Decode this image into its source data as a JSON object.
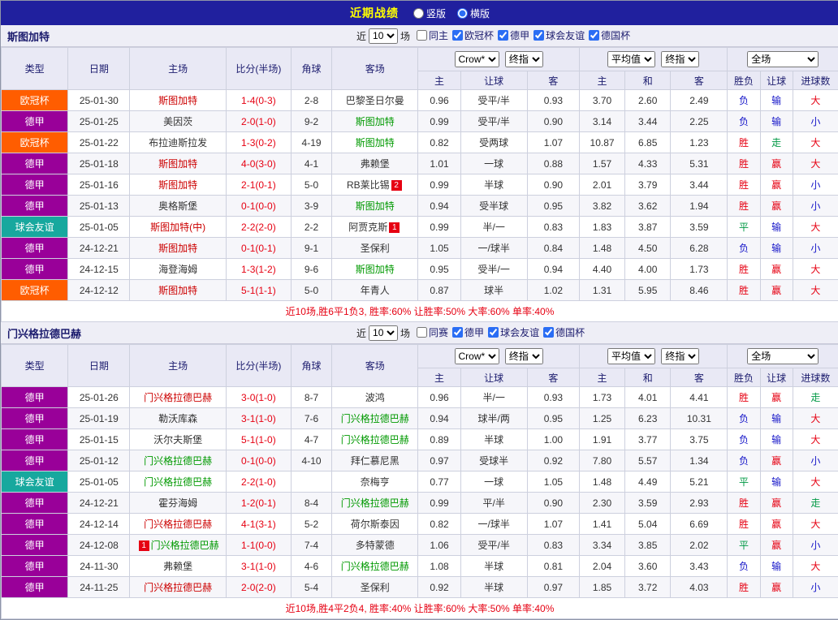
{
  "topbar": {
    "title": "近期战绩",
    "layout_options": [
      {
        "key": "vertical",
        "label": "竖版",
        "selected": false
      },
      {
        "key": "horizontal",
        "label": "横版",
        "selected": true
      }
    ]
  },
  "filter": {
    "prefix": "近",
    "count": "10",
    "suffix": "场"
  },
  "table_header": {
    "cols": [
      "类型",
      "日期",
      "主场",
      "比分(半场)",
      "角球",
      "客场"
    ],
    "odds_group": {
      "select1": "Crow*",
      "select2": "终指",
      "sub": [
        "主",
        "让球",
        "客"
      ]
    },
    "avg_group": {
      "select1": "平均值",
      "select2": "终指",
      "sub": [
        "主",
        "和",
        "客"
      ]
    },
    "result_group": {
      "select": "全场",
      "sub": [
        "胜负",
        "让球",
        "进球数"
      ]
    }
  },
  "colors": {
    "type_badges": {
      "欧冠杯": "#ff5d00",
      "德甲": "#990099",
      "球会友谊": "#17a89e"
    },
    "team": {
      "red": "#cc0000",
      "green": "#009900",
      "black": "#333333"
    },
    "results": {
      "胜": "#e60012",
      "赢": "#e60012",
      "大": "#e60012",
      "负": "#1414c8",
      "输": "#1414c8",
      "小": "#1414c8",
      "平": "#009944",
      "走": "#009944"
    },
    "score": "#e60012",
    "topbar_bg": "#20209e",
    "title_color": "#ffff00"
  },
  "sections": [
    {
      "key": "stuttgart",
      "team": "斯图加特",
      "filters": [
        {
          "key": "same-home",
          "label": "同主",
          "checked": false
        },
        {
          "key": "ucl",
          "label": "欧冠杯",
          "checked": true
        },
        {
          "key": "bundesliga",
          "label": "德甲",
          "checked": true
        },
        {
          "key": "club-friendly",
          "label": "球会友谊",
          "checked": true
        },
        {
          "key": "german-cup",
          "label": "德国杯",
          "checked": true
        }
      ],
      "rows": [
        {
          "type": "欧冠杯",
          "date": "25-01-30",
          "home": {
            "name": "斯图加特",
            "color": "red"
          },
          "score": "1-4(0-3)",
          "corner": "2-8",
          "away": {
            "name": "巴黎圣日尔曼",
            "color": "black"
          },
          "odds": [
            "0.96",
            "受平/半",
            "0.93"
          ],
          "avg": [
            "3.70",
            "2.60",
            "2.49"
          ],
          "results": [
            "负",
            "输",
            "大"
          ]
        },
        {
          "type": "德甲",
          "date": "25-01-25",
          "home": {
            "name": "美因茨",
            "color": "black"
          },
          "score": "2-0(1-0)",
          "corner": "9-2",
          "away": {
            "name": "斯图加特",
            "color": "green"
          },
          "odds": [
            "0.99",
            "受平/半",
            "0.90"
          ],
          "avg": [
            "3.14",
            "3.44",
            "2.25"
          ],
          "results": [
            "负",
            "输",
            "小"
          ]
        },
        {
          "type": "欧冠杯",
          "date": "25-01-22",
          "home": {
            "name": "布拉迪斯拉发",
            "color": "black"
          },
          "score": "1-3(0-2)",
          "corner": "4-19",
          "away": {
            "name": "斯图加特",
            "color": "green"
          },
          "odds": [
            "0.82",
            "受两球",
            "1.07"
          ],
          "avg": [
            "10.87",
            "6.85",
            "1.23"
          ],
          "results": [
            "胜",
            "走",
            "大"
          ]
        },
        {
          "type": "德甲",
          "date": "25-01-18",
          "home": {
            "name": "斯图加特",
            "color": "red"
          },
          "score": "4-0(3-0)",
          "corner": "4-1",
          "away": {
            "name": "弗赖堡",
            "color": "black"
          },
          "odds": [
            "1.01",
            "一球",
            "0.88"
          ],
          "avg": [
            "1.57",
            "4.33",
            "5.31"
          ],
          "results": [
            "胜",
            "赢",
            "大"
          ]
        },
        {
          "type": "德甲",
          "date": "25-01-16",
          "home": {
            "name": "斯图加特",
            "color": "red"
          },
          "score": "2-1(0-1)",
          "corner": "5-0",
          "away": {
            "name": "RB莱比锡",
            "color": "black",
            "badge": "2"
          },
          "odds": [
            "0.99",
            "半球",
            "0.90"
          ],
          "avg": [
            "2.01",
            "3.79",
            "3.44"
          ],
          "results": [
            "胜",
            "赢",
            "小"
          ]
        },
        {
          "type": "德甲",
          "date": "25-01-13",
          "home": {
            "name": "奥格斯堡",
            "color": "black"
          },
          "score": "0-1(0-0)",
          "corner": "3-9",
          "away": {
            "name": "斯图加特",
            "color": "green"
          },
          "odds": [
            "0.94",
            "受半球",
            "0.95"
          ],
          "avg": [
            "3.82",
            "3.62",
            "1.94"
          ],
          "results": [
            "胜",
            "赢",
            "小"
          ]
        },
        {
          "type": "球会友谊",
          "date": "25-01-05",
          "home": {
            "name": "斯图加特(中)",
            "color": "red"
          },
          "score": "2-2(2-0)",
          "corner": "2-2",
          "away": {
            "name": "阿贾克斯",
            "color": "black",
            "badge": "1"
          },
          "odds": [
            "0.99",
            "半/一",
            "0.83"
          ],
          "avg": [
            "1.83",
            "3.87",
            "3.59"
          ],
          "results": [
            "平",
            "输",
            "大"
          ]
        },
        {
          "type": "德甲",
          "date": "24-12-21",
          "home": {
            "name": "斯图加特",
            "color": "red"
          },
          "score": "0-1(0-1)",
          "corner": "9-1",
          "away": {
            "name": "圣保利",
            "color": "black"
          },
          "odds": [
            "1.05",
            "一/球半",
            "0.84"
          ],
          "avg": [
            "1.48",
            "4.50",
            "6.28"
          ],
          "results": [
            "负",
            "输",
            "小"
          ]
        },
        {
          "type": "德甲",
          "date": "24-12-15",
          "home": {
            "name": "海登海姆",
            "color": "black"
          },
          "score": "1-3(1-2)",
          "corner": "9-6",
          "away": {
            "name": "斯图加特",
            "color": "green"
          },
          "odds": [
            "0.95",
            "受半/一",
            "0.94"
          ],
          "avg": [
            "4.40",
            "4.00",
            "1.73"
          ],
          "results": [
            "胜",
            "赢",
            "大"
          ]
        },
        {
          "type": "欧冠杯",
          "date": "24-12-12",
          "home": {
            "name": "斯图加特",
            "color": "red"
          },
          "score": "5-1(1-1)",
          "corner": "5-0",
          "away": {
            "name": "年青人",
            "color": "black"
          },
          "odds": [
            "0.87",
            "球半",
            "1.02"
          ],
          "avg": [
            "1.31",
            "5.95",
            "8.46"
          ],
          "results": [
            "胜",
            "赢",
            "大"
          ]
        }
      ],
      "summary": "近10场,胜6平1负3, 胜率:60% 让胜率:50% 大率:60% 单率:40%"
    },
    {
      "key": "gladbach",
      "team": "门兴格拉德巴赫",
      "filters": [
        {
          "key": "same-competition",
          "label": "同赛",
          "checked": false
        },
        {
          "key": "bundesliga",
          "label": "德甲",
          "checked": true
        },
        {
          "key": "club-friendly",
          "label": "球会友谊",
          "checked": true
        },
        {
          "key": "german-cup",
          "label": "德国杯",
          "checked": true
        }
      ],
      "rows": [
        {
          "type": "德甲",
          "date": "25-01-26",
          "home": {
            "name": "门兴格拉德巴赫",
            "color": "red"
          },
          "score": "3-0(1-0)",
          "corner": "8-7",
          "away": {
            "name": "波鸿",
            "color": "black"
          },
          "odds": [
            "0.96",
            "半/一",
            "0.93"
          ],
          "avg": [
            "1.73",
            "4.01",
            "4.41"
          ],
          "results": [
            "胜",
            "赢",
            "走"
          ]
        },
        {
          "type": "德甲",
          "date": "25-01-19",
          "home": {
            "name": "勒沃库森",
            "color": "black"
          },
          "score": "3-1(1-0)",
          "corner": "7-6",
          "away": {
            "name": "门兴格拉德巴赫",
            "color": "green"
          },
          "odds": [
            "0.94",
            "球半/两",
            "0.95"
          ],
          "avg": [
            "1.25",
            "6.23",
            "10.31"
          ],
          "results": [
            "负",
            "输",
            "大"
          ]
        },
        {
          "type": "德甲",
          "date": "25-01-15",
          "home": {
            "name": "沃尔夫斯堡",
            "color": "black"
          },
          "score": "5-1(1-0)",
          "corner": "4-7",
          "away": {
            "name": "门兴格拉德巴赫",
            "color": "green"
          },
          "odds": [
            "0.89",
            "半球",
            "1.00"
          ],
          "avg": [
            "1.91",
            "3.77",
            "3.75"
          ],
          "results": [
            "负",
            "输",
            "大"
          ]
        },
        {
          "type": "德甲",
          "date": "25-01-12",
          "home": {
            "name": "门兴格拉德巴赫",
            "color": "green"
          },
          "score": "0-1(0-0)",
          "corner": "4-10",
          "away": {
            "name": "拜仁慕尼黑",
            "color": "black"
          },
          "odds": [
            "0.97",
            "受球半",
            "0.92"
          ],
          "avg": [
            "7.80",
            "5.57",
            "1.34"
          ],
          "results": [
            "负",
            "赢",
            "小"
          ]
        },
        {
          "type": "球会友谊",
          "date": "25-01-05",
          "home": {
            "name": "门兴格拉德巴赫",
            "color": "green"
          },
          "score": "2-2(1-0)",
          "corner": "",
          "away": {
            "name": "奈梅亨",
            "color": "black"
          },
          "odds": [
            "0.77",
            "一球",
            "1.05"
          ],
          "avg": [
            "1.48",
            "4.49",
            "5.21"
          ],
          "results": [
            "平",
            "输",
            "大"
          ]
        },
        {
          "type": "德甲",
          "date": "24-12-21",
          "home": {
            "name": "霍芬海姆",
            "color": "black"
          },
          "score": "1-2(0-1)",
          "corner": "8-4",
          "away": {
            "name": "门兴格拉德巴赫",
            "color": "green"
          },
          "odds": [
            "0.99",
            "平/半",
            "0.90"
          ],
          "avg": [
            "2.30",
            "3.59",
            "2.93"
          ],
          "results": [
            "胜",
            "赢",
            "走"
          ]
        },
        {
          "type": "德甲",
          "date": "24-12-14",
          "home": {
            "name": "门兴格拉德巴赫",
            "color": "red"
          },
          "score": "4-1(3-1)",
          "corner": "5-2",
          "away": {
            "name": "荷尔斯泰因",
            "color": "black"
          },
          "odds": [
            "0.82",
            "一/球半",
            "1.07"
          ],
          "avg": [
            "1.41",
            "5.04",
            "6.69"
          ],
          "results": [
            "胜",
            "赢",
            "大"
          ]
        },
        {
          "type": "德甲",
          "date": "24-12-08",
          "home": {
            "name": "门兴格拉德巴赫",
            "color": "green",
            "badge": "1"
          },
          "score": "1-1(0-0)",
          "corner": "7-4",
          "away": {
            "name": "多特蒙德",
            "color": "black"
          },
          "odds": [
            "1.06",
            "受平/半",
            "0.83"
          ],
          "avg": [
            "3.34",
            "3.85",
            "2.02"
          ],
          "results": [
            "平",
            "赢",
            "小"
          ]
        },
        {
          "type": "德甲",
          "date": "24-11-30",
          "home": {
            "name": "弗赖堡",
            "color": "black"
          },
          "score": "3-1(1-0)",
          "corner": "4-6",
          "away": {
            "name": "门兴格拉德巴赫",
            "color": "green"
          },
          "odds": [
            "1.08",
            "半球",
            "0.81"
          ],
          "avg": [
            "2.04",
            "3.60",
            "3.43"
          ],
          "results": [
            "负",
            "输",
            "大"
          ]
        },
        {
          "type": "德甲",
          "date": "24-11-25",
          "home": {
            "name": "门兴格拉德巴赫",
            "color": "red"
          },
          "score": "2-0(2-0)",
          "corner": "5-4",
          "away": {
            "name": "圣保利",
            "color": "black"
          },
          "odds": [
            "0.92",
            "半球",
            "0.97"
          ],
          "avg": [
            "1.85",
            "3.72",
            "4.03"
          ],
          "results": [
            "胜",
            "赢",
            "小"
          ]
        }
      ],
      "summary": "近10场,胜4平2负4, 胜率:40% 让胜率:60% 大率:50% 单率:40%"
    }
  ]
}
